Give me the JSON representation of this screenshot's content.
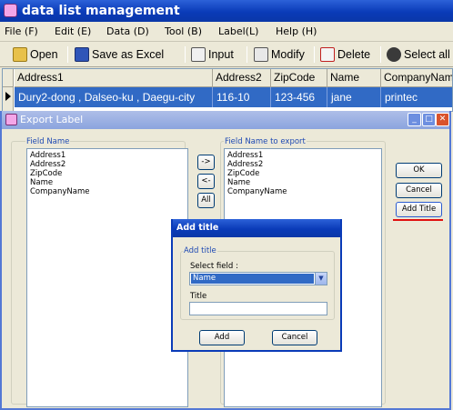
{
  "main_window": {
    "title": "data list management"
  },
  "menu": [
    {
      "label": "File (F)"
    },
    {
      "label": "Edit (E)"
    },
    {
      "label": "Data (D)"
    },
    {
      "label": "Tool (B)"
    },
    {
      "label": "Label(L)"
    },
    {
      "label": "Help (H)"
    }
  ],
  "toolbar": {
    "open": "Open",
    "save_excel": "Save as Excel",
    "input": "Input",
    "modify": "Modify",
    "delete": "Delete",
    "select_all": "Select all"
  },
  "grid": {
    "columns": [
      "Address1",
      "Address2",
      "ZipCode",
      "Name",
      "CompanyName"
    ],
    "rows": [
      [
        "Dury2-dong , Dalseo-ku , Daegu-city",
        "116-10",
        "123-456",
        "jane",
        "printec"
      ]
    ]
  },
  "export_window": {
    "title": "Export Label",
    "field_name_legend": "Field Name",
    "export_legend": "Field Name to export",
    "field_names": [
      "Address1",
      "Address2",
      "ZipCode",
      "Name",
      "CompanyName"
    ],
    "export_fields": [
      "Address1",
      "Address2",
      "ZipCode",
      "Name",
      "CompanyName"
    ],
    "move_right": "->",
    "move_left": "<-",
    "all": "All",
    "ok": "OK",
    "cancel": "Cancel",
    "add_title": "Add Title"
  },
  "add_title_dialog": {
    "title": "Add title",
    "group_legend": "Add title",
    "select_field_label": "Select field :",
    "selected_field": "Name",
    "title_label": "Title",
    "title_value": "",
    "add": "Add",
    "cancel": "Cancel"
  },
  "colors": {
    "titlebar": "#0a3bb8",
    "selection": "#316ac5",
    "highlight_line": "#e01010"
  }
}
